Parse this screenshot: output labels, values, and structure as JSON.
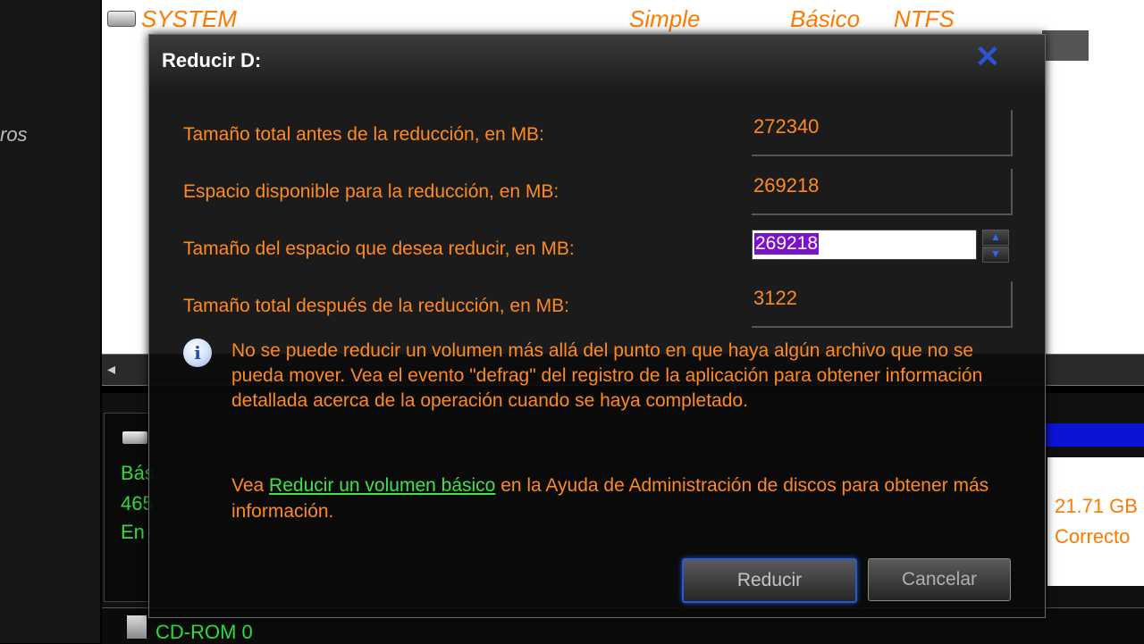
{
  "background": {
    "left_fragment": "ros",
    "volume_row": {
      "name": "SYSTEM",
      "layout": "Simple",
      "type": "Básico",
      "fs": "NTFS"
    },
    "disk": {
      "line1": "Bás",
      "line2": "465",
      "line3": "En"
    },
    "partition_right": {
      "size": "21.71 GB",
      "status": "Correcto"
    },
    "cdrom": "CD-ROM 0"
  },
  "dialog": {
    "title": "Reducir D:",
    "close_glyph": "✕",
    "fields": [
      {
        "label": "Tamaño total antes de la reducción, en MB:",
        "value": "272340"
      },
      {
        "label": "Espacio disponible para la reducción, en MB:",
        "value": "269218"
      },
      {
        "label": "Tamaño del espacio que desea reducir, en MB:",
        "value": "269218"
      },
      {
        "label": "Tamaño total después de la reducción, en MB:",
        "value": "3122"
      }
    ],
    "info_icon": "i",
    "info_text": "No se puede reducir un volumen más allá del punto en que haya algún archivo que no se pueda mover. Vea el evento \"defrag\" del registro de la aplicación para obtener información detallada acerca de la operación cuando se haya completado.",
    "help": {
      "prefix": "Vea ",
      "link": "Reducir un volumen básico",
      "suffix": " en la Ayuda de Administración de discos para obtener más información."
    },
    "buttons": {
      "reduce": "Reducir",
      "cancel": "Cancelar"
    }
  },
  "colors": {
    "label": "#ff8a1e",
    "link": "#3fe24a",
    "selection": "#7c12c8",
    "accent_blue": "#2b55d6"
  }
}
